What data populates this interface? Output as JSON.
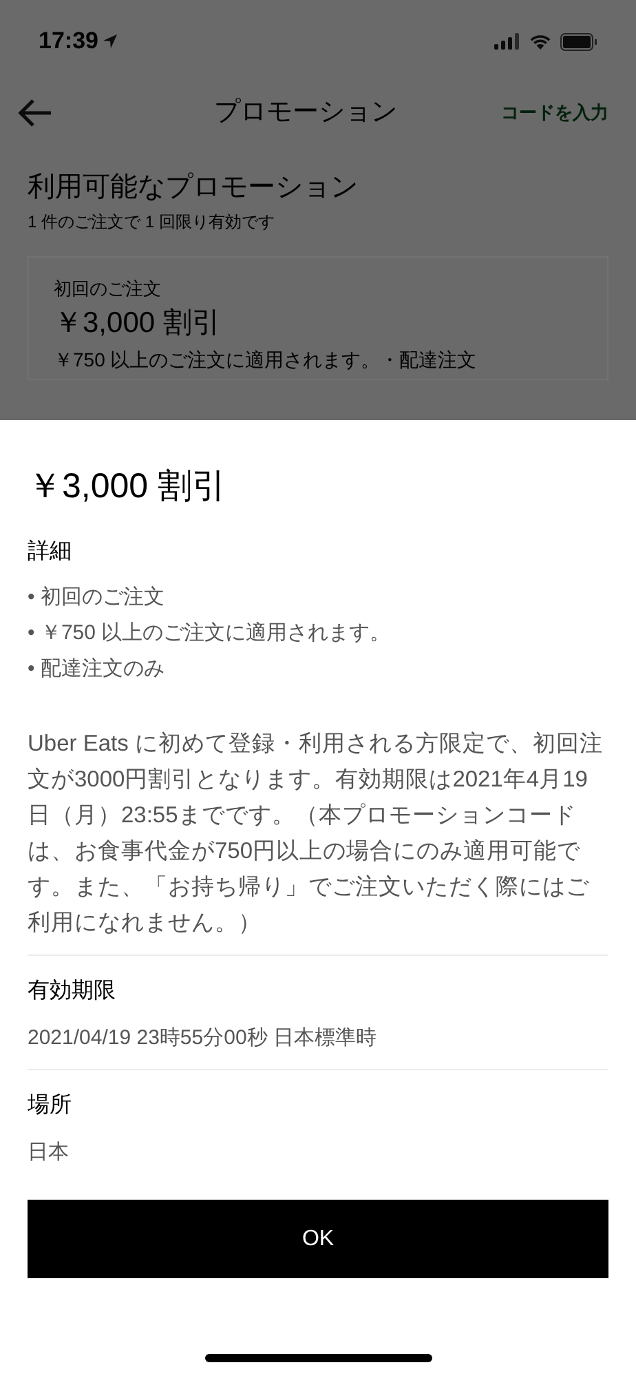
{
  "status_bar": {
    "time": "17:39"
  },
  "nav": {
    "title": "プロモーション",
    "action": "コードを入力"
  },
  "section": {
    "title": "利用可能なプロモーション",
    "subtitle": "1 件のご注文で 1 回限り有効です"
  },
  "promo_card": {
    "label": "初回のご注文",
    "title": "￥3,000 割引",
    "description": "￥750 以上のご注文に適用されます。・配達注文"
  },
  "sheet": {
    "title": "￥3,000 割引",
    "details_heading": "詳細",
    "details": [
      "初回のご注文",
      "￥750 以上のご注文に適用されます。",
      "配達注文のみ"
    ],
    "bullet": "•",
    "description": "Uber Eats に初めて登録・利用される方限定で、初回注文が3000円割引となります。有効期限は2021年4月19日（月）23:55までです。（本プロモーションコードは、お食事代金が750円以上の場合にのみ適用可能です。また、「お持ち帰り」でご注文いただく際にはご利用になれません。）",
    "sections": [
      {
        "heading": "有効期限",
        "value": "2021/04/19 23時55分00秒 日本標準時"
      },
      {
        "heading": "場所",
        "value": "日本"
      }
    ],
    "button": "OK"
  }
}
